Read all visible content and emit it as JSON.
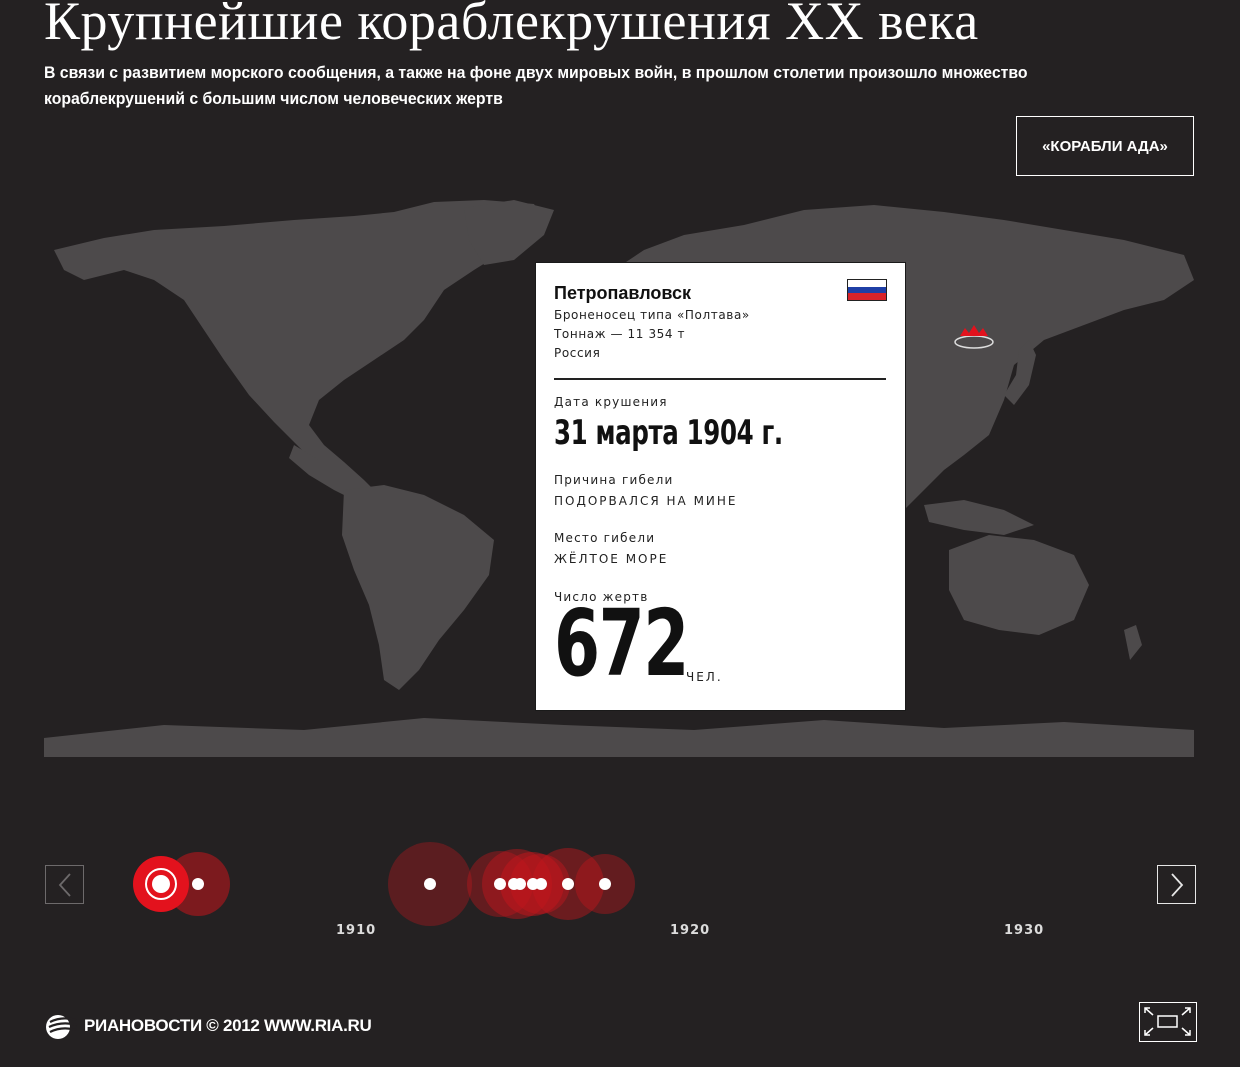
{
  "header": {
    "title": "Крупнейшие кораблекрушения XX века",
    "subtitle": "В связи с развитием морского сообщения, а также на фоне двух мировых войн, в прошлом столетии произошло множество кораблекрушений с большим числом человеческих жертв",
    "hell_ships_button": "«КОРАБЛИ АДА»"
  },
  "card": {
    "ship_name": "Петропавловск",
    "ship_type": "Броненосец типа «Полтава»",
    "tonnage": "Тоннаж — 11 354 т",
    "country": "Россия",
    "flag_colors": [
      "#ffffff",
      "#1f3fa6",
      "#d8232a"
    ],
    "date_label": "Дата крушения",
    "date_value": "31 марта 1904 г.",
    "cause_label": "Причина гибели",
    "cause_value": "ПОДОРВАЛСЯ НА МИНЕ",
    "place_label": "Место гибели",
    "place_value": "ЖЁЛТОЕ МОРЕ",
    "victims_label": "Число жертв",
    "victims_value": "672",
    "victims_unit": "ЧЕЛ."
  },
  "timeline": {
    "years": [
      "1910",
      "1920",
      "1930"
    ],
    "prev_icon": "chevron-left-icon",
    "next_icon": "chevron-right-icon"
  },
  "footer": {
    "brand": "РИАНОВОСТИ © 2012 WWW.RIA.RU",
    "logo_icon": "ria-logo-icon",
    "fullscreen_icon": "fullscreen-icon"
  },
  "colors": {
    "background": "#242122",
    "land": "#4d4a4b",
    "accent_red": "#e3121d",
    "marker_red": "#c4161c"
  }
}
